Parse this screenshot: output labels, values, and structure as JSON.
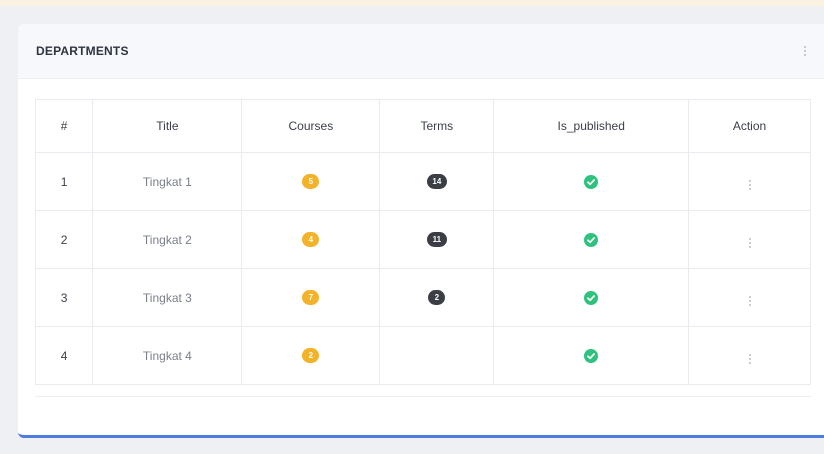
{
  "panel": {
    "title": "DEPARTMENTS"
  },
  "table": {
    "headers": [
      "#",
      "Title",
      "Courses",
      "Terms",
      "Is_published",
      "Action"
    ],
    "rows": [
      {
        "num": "1",
        "title": "Tingkat 1",
        "courses": "5",
        "terms": "14",
        "is_published": true
      },
      {
        "num": "2",
        "title": "Tingkat 2",
        "courses": "4",
        "terms": "11",
        "is_published": true
      },
      {
        "num": "3",
        "title": "Tingkat 3",
        "courses": "7",
        "terms": "2",
        "is_published": true
      },
      {
        "num": "4",
        "title": "Tingkat 4",
        "courses": "2",
        "terms": "",
        "is_published": true
      }
    ]
  },
  "icons": {
    "panel_menu": "kebab-menu-icon",
    "row_action": "kebab-menu-icon",
    "published": "check-circle-icon"
  },
  "colors": {
    "courses_badge": "#f2b22a",
    "terms_badge": "#3b3e45",
    "published_check": "#2ec27e",
    "accent_border": "#4f7ae0"
  }
}
